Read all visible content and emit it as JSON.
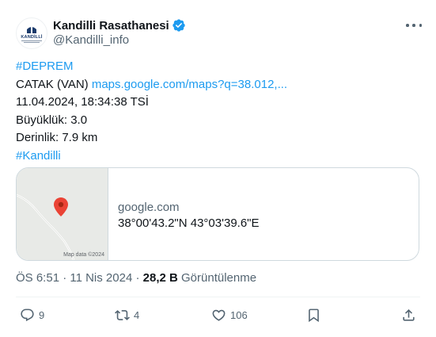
{
  "author": {
    "display_name": "Kandilli Rasathanesi",
    "handle": "@Kandilli_info",
    "avatar_text": "KANDİLLİ",
    "verified": true,
    "verified_color": "#1d9bf0"
  },
  "tweet": {
    "hashtag_1": "#DEPREM",
    "location": "CATAK (VAN) ",
    "map_link": "maps.google.com/maps?q=38.012,...",
    "datetime": "11.04.2024, 18:34:38 TSİ",
    "magnitude": "Büyüklük: 3.0",
    "depth": "Derinlik: 7.9 km",
    "hashtag_2": "#Kandilli"
  },
  "card": {
    "domain": "google.com",
    "title": "38°00'43.2\"N 43°03'39.6\"E",
    "map_attribution": "Map data ©2024"
  },
  "meta": {
    "timestamp": "ÖS 6:51 · 11 Nis 2024 · ",
    "views_count": "28,2 B",
    "views_label": " Görüntülenme"
  },
  "actions": {
    "reply_count": "9",
    "retweet_count": "4",
    "like_count": "106"
  },
  "colors": {
    "link": "#1d9bf0",
    "text": "#0f1419",
    "secondary": "#536471",
    "map_pin": "#ea4335"
  },
  "icons": [
    "verified-badge-icon",
    "more-icon",
    "map-pin-icon",
    "reply-icon",
    "retweet-icon",
    "like-icon",
    "bookmark-icon",
    "share-icon"
  ]
}
